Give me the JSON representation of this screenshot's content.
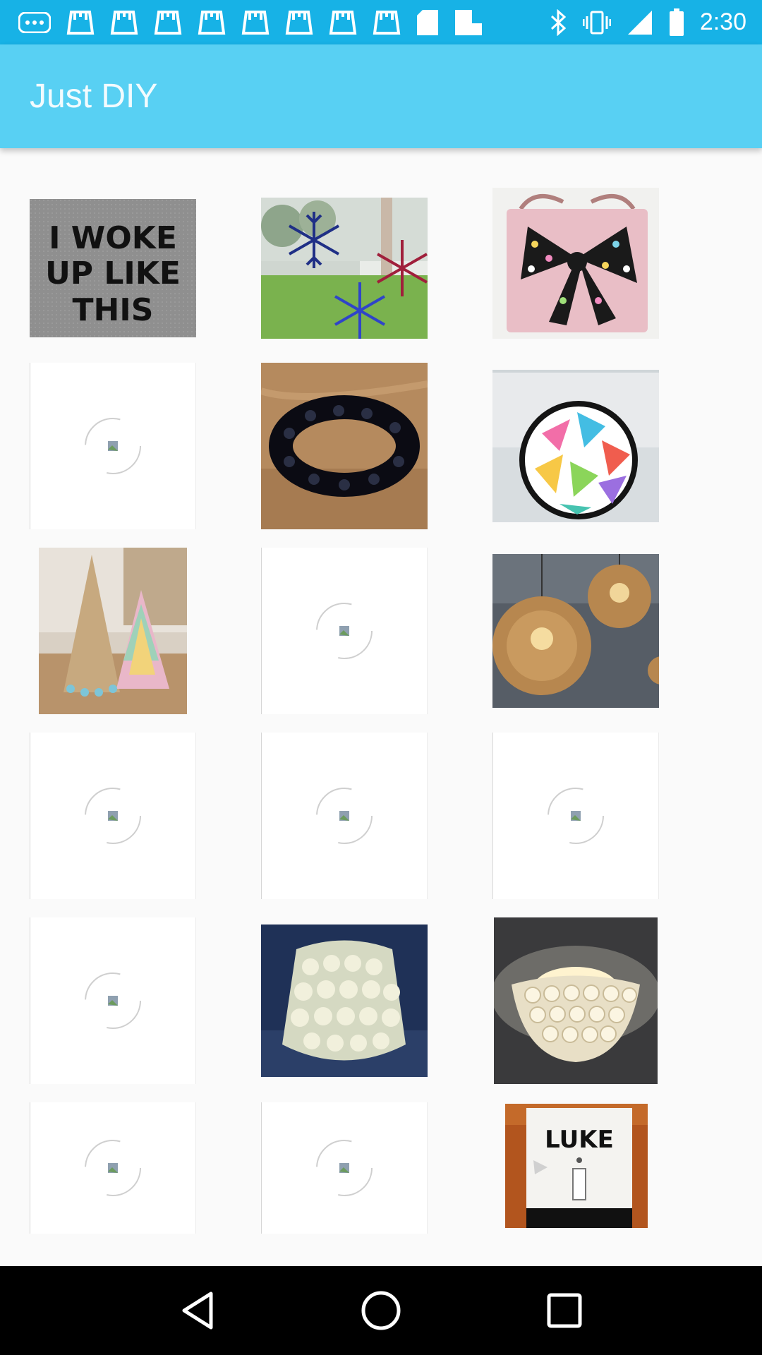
{
  "status_bar": {
    "time": "2:30",
    "left_icons": [
      "chat-icon",
      "app-icon",
      "app-icon",
      "app-icon",
      "app-icon",
      "app-icon",
      "app-icon",
      "app-icon",
      "app-icon",
      "sd-card-icon",
      "file-icon"
    ],
    "right_icons": [
      "bluetooth-icon",
      "vibrate-icon",
      "signal-icon",
      "battery-icon"
    ]
  },
  "app_bar": {
    "title": "Just DIY"
  },
  "grid": {
    "items": [
      {
        "kind": "image",
        "subject": "I WOKE UP LIKE THIS sign",
        "text": "I WOKE UP LIKE THIS"
      },
      {
        "kind": "image",
        "subject": "paper snowflakes on window"
      },
      {
        "kind": "image",
        "subject": "pink bag with polka dot bow"
      },
      {
        "kind": "placeholder"
      },
      {
        "kind": "image",
        "subject": "black beaded bracelet"
      },
      {
        "kind": "image",
        "subject": "colorful triangle hoop art"
      },
      {
        "kind": "image",
        "subject": "cone christmas trees"
      },
      {
        "kind": "placeholder"
      },
      {
        "kind": "image",
        "subject": "twine ball pendant lamps"
      },
      {
        "kind": "placeholder"
      },
      {
        "kind": "placeholder"
      },
      {
        "kind": "placeholder"
      },
      {
        "kind": "placeholder"
      },
      {
        "kind": "image",
        "subject": "spoon lampshade"
      },
      {
        "kind": "image",
        "subject": "spoon ceiling light"
      },
      {
        "kind": "placeholder"
      },
      {
        "kind": "placeholder"
      },
      {
        "kind": "image",
        "subject": "LUKE light switch plate",
        "text": "LUKE"
      }
    ]
  },
  "nav_bar": {
    "buttons": [
      "back-icon",
      "home-icon",
      "recents-icon"
    ]
  },
  "colors": {
    "status_bar": "#17b2e6",
    "app_bar": "#58d0f3",
    "background": "#fafafa",
    "nav_bar": "#000000"
  }
}
